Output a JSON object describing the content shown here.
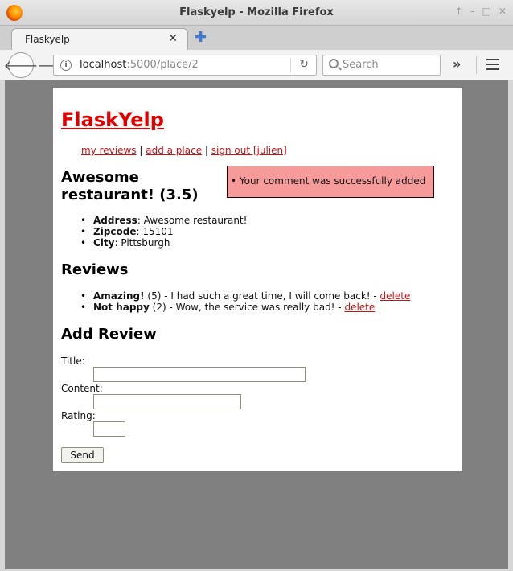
{
  "window": {
    "title": "Flaskyelp - Mozilla Firefox",
    "controls": [
      "↑",
      "–",
      "□",
      "✕"
    ]
  },
  "tab": {
    "label": "Flaskyelp",
    "close": "✕",
    "new_tab": "✚"
  },
  "toolbar": {
    "url_host": "localhost",
    "url_path": ":5000/place/2",
    "search_placeholder": "Search",
    "overflow": "»"
  },
  "page": {
    "brand": "FlaskYelp",
    "nav": [
      {
        "label": "my reviews"
      },
      {
        "label": "add a place"
      },
      {
        "label": "sign out [julien]"
      }
    ],
    "nav_separator": " | ",
    "place_title": "Awesome restaurant! (3.5)",
    "flash_message": "Your comment was successfully added",
    "details": [
      {
        "key": "Address",
        "value": ": Awesome restaurant!"
      },
      {
        "key": "Zipcode",
        "value": ": 15101"
      },
      {
        "key": "City",
        "value": ": Pittsburgh"
      }
    ],
    "reviews_heading": "Reviews",
    "reviews": [
      {
        "title": "Amazing!",
        "rest": " (5) - I had such a great time, I will come back! - ",
        "delete": "delete"
      },
      {
        "title": "Not happy",
        "rest": " (2) - Wow, the service was really bad! - ",
        "delete": "delete"
      }
    ],
    "add_review_heading": "Add Review",
    "form": {
      "title_label": "Title:",
      "content_label": "Content:",
      "rating_label": "Rating:",
      "title_value": "",
      "content_value": "",
      "rating_value": "",
      "send_label": "Send"
    }
  }
}
